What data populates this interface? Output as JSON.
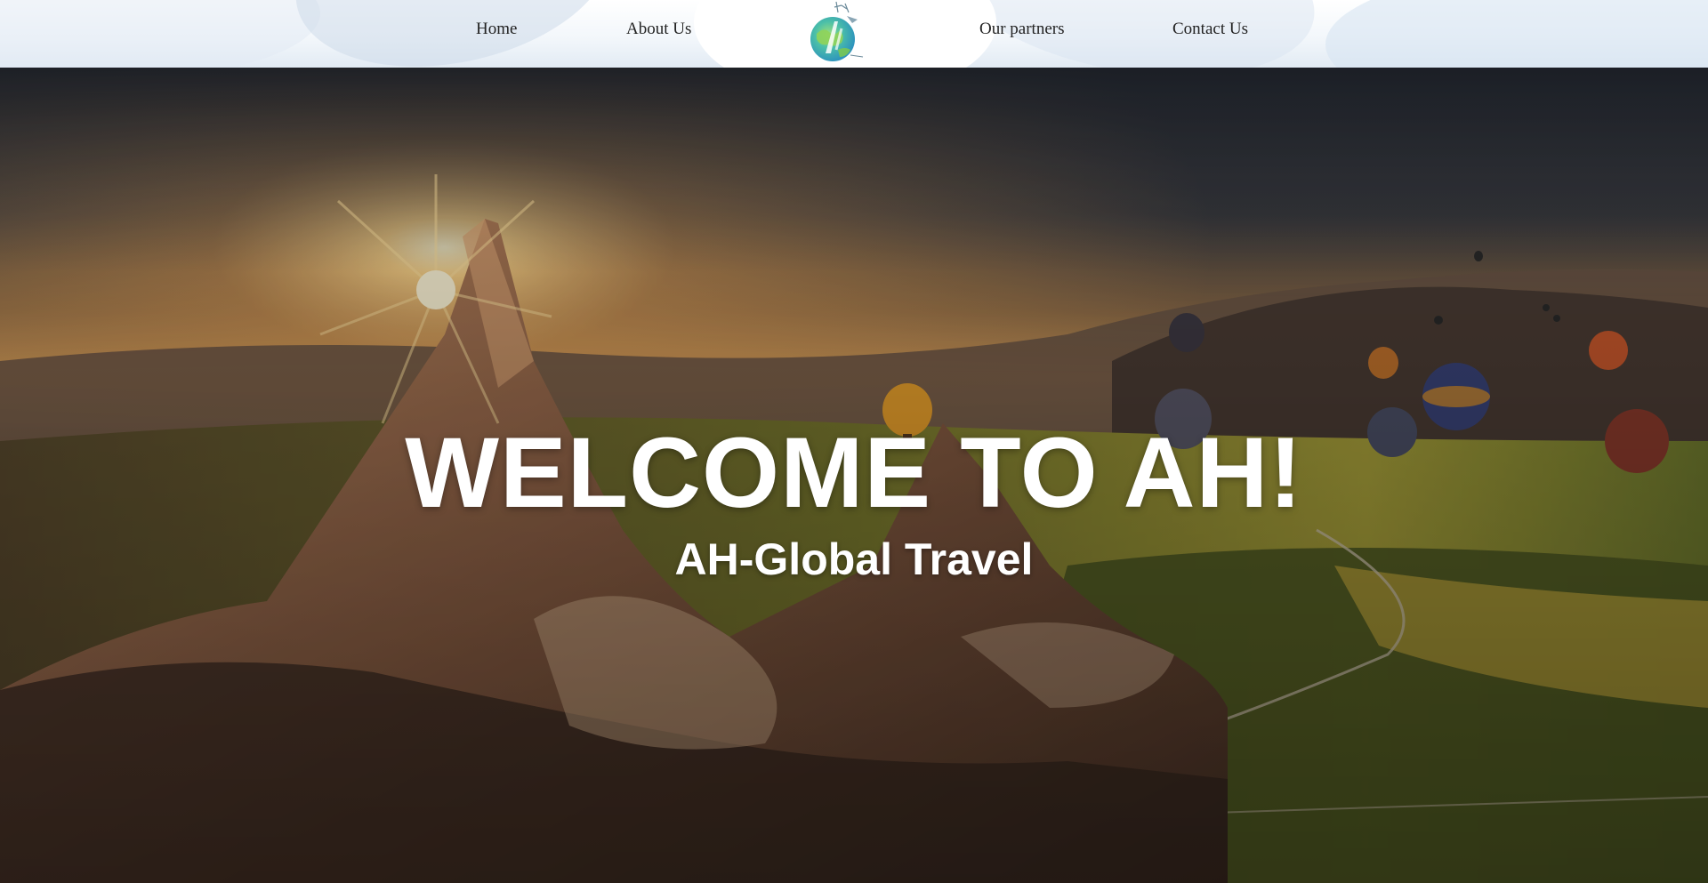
{
  "nav": {
    "home": "Home",
    "about": "About Us",
    "partners": "Our partners",
    "contact": "Contact Us"
  },
  "logo": {
    "icon": "globe-logo-icon",
    "colors": [
      "#3fb7d6",
      "#8ccf4d",
      "#2a8fbf"
    ]
  },
  "hero": {
    "title": "WELCOME TO AH!",
    "subtitle": "AH-Global Travel",
    "background": "cappadocia-hot-air-balloons-sunrise"
  },
  "colors": {
    "nav_text": "#222222",
    "hero_text": "#ffffff"
  }
}
